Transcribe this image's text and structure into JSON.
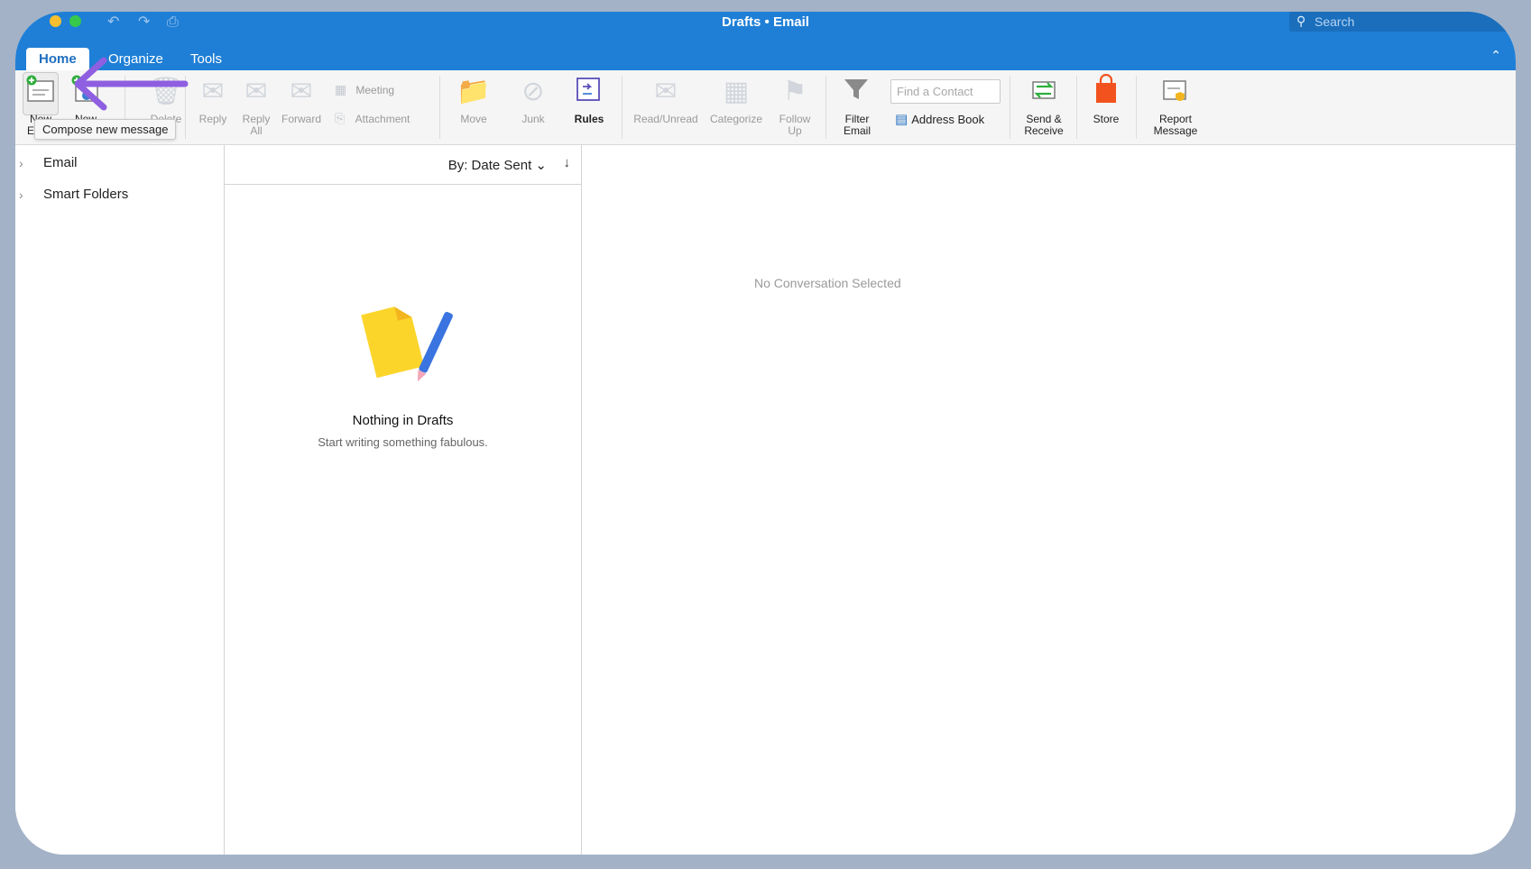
{
  "window": {
    "title": "Drafts • Email",
    "search_placeholder": "Search"
  },
  "tabs": [
    {
      "label": "Home",
      "active": true
    },
    {
      "label": "Organize",
      "active": false
    },
    {
      "label": "Tools",
      "active": false
    }
  ],
  "ribbon": {
    "new_email": "New Email",
    "new_items": "New Items",
    "delete": "Delete",
    "reply": "Reply",
    "reply_all": "Reply All",
    "forward": "Forward",
    "meeting": "Meeting",
    "attachment": "Attachment",
    "move": "Move",
    "junk": "Junk",
    "rules": "Rules",
    "read_unread": "Read/Unread",
    "categorize": "Categorize",
    "follow_up": "Follow Up",
    "filter_email": "Filter Email",
    "find_contact_placeholder": "Find a Contact",
    "address_book": "Address Book",
    "send_receive": "Send & Receive",
    "store": "Store",
    "report_message": "Report Message"
  },
  "tooltip": "Compose new message",
  "folders": [
    {
      "label": "Email"
    },
    {
      "label": "Smart Folders"
    }
  ],
  "message_list": {
    "sort_label": "By: Date Sent",
    "empty_title": "Nothing in Drafts",
    "empty_subtitle": "Start writing something fabulous."
  },
  "reading_pane": {
    "empty_text": "No Conversation Selected"
  },
  "colors": {
    "accent": "#1f7fd6",
    "annotation_arrow": "#8e5fe0",
    "store": "#f2531e"
  }
}
